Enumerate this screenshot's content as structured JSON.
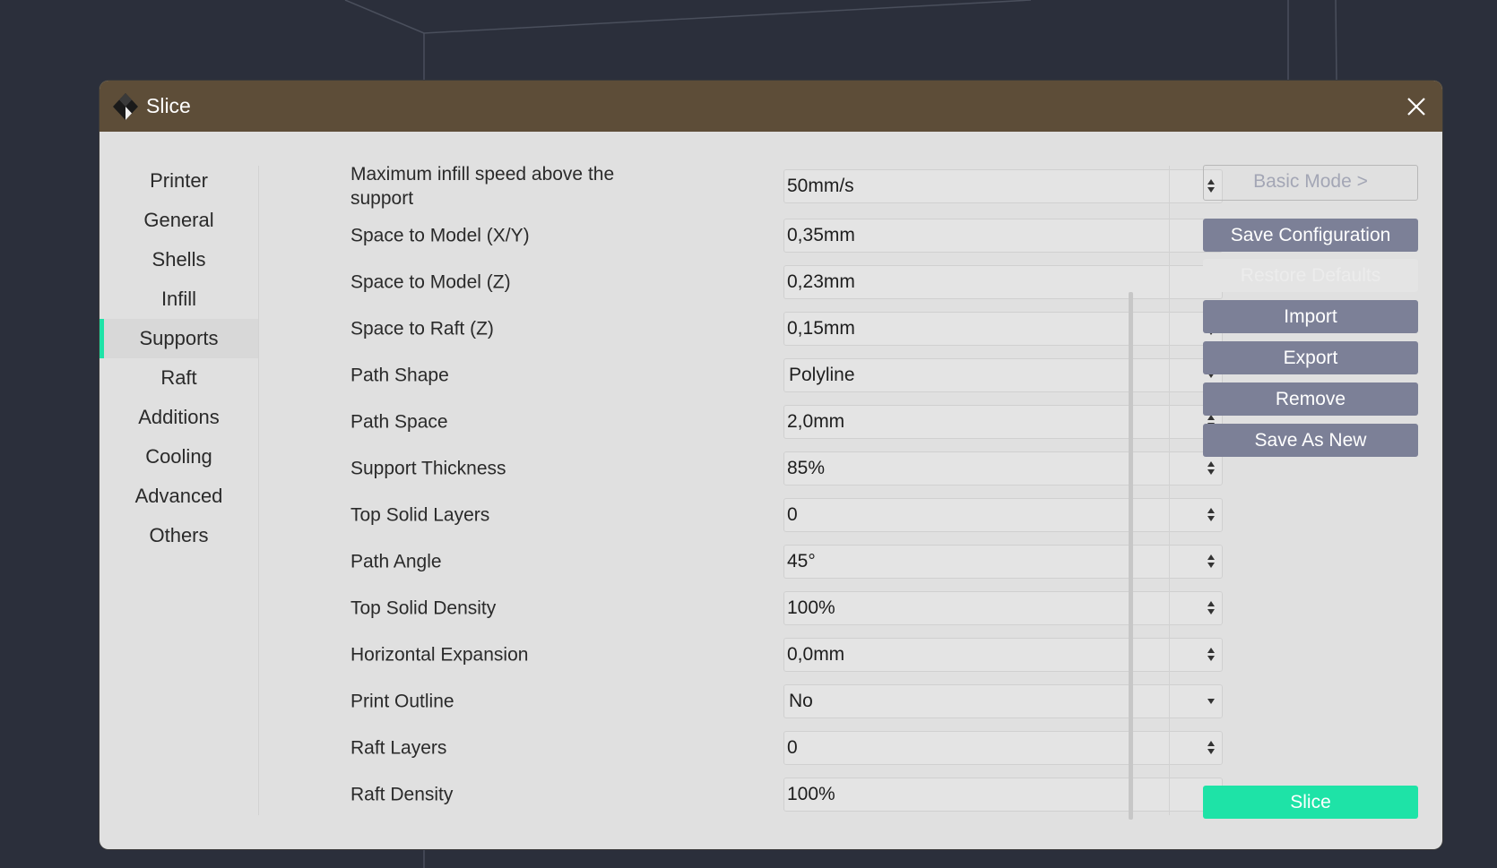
{
  "window": {
    "title": "Slice"
  },
  "sidebar": {
    "items": [
      {
        "label": "Printer"
      },
      {
        "label": "General"
      },
      {
        "label": "Shells"
      },
      {
        "label": "Infill"
      },
      {
        "label": "Supports",
        "active": true
      },
      {
        "label": "Raft"
      },
      {
        "label": "Additions"
      },
      {
        "label": "Cooling"
      },
      {
        "label": "Advanced"
      },
      {
        "label": "Others"
      }
    ]
  },
  "settings": {
    "rows": [
      {
        "label": "Maximum infill speed above the support",
        "value": "50mm/s",
        "control": "spinbox"
      },
      {
        "label": "Space to Model (X/Y)",
        "value": "0,35mm",
        "control": "spinbox"
      },
      {
        "label": "Space to Model (Z)",
        "value": "0,23mm",
        "control": "spinbox"
      },
      {
        "label": "Space to Raft (Z)",
        "value": "0,15mm",
        "control": "spinbox"
      },
      {
        "label": "Path Shape",
        "value": "Polyline",
        "control": "dropdown"
      },
      {
        "label": "Path Space",
        "value": "2,0mm",
        "control": "spinbox"
      },
      {
        "label": "Support Thickness",
        "value": "85%",
        "control": "spinbox"
      },
      {
        "label": "Top Solid Layers",
        "value": "0",
        "control": "spinbox"
      },
      {
        "label": "Path Angle",
        "value": "45°",
        "control": "spinbox"
      },
      {
        "label": "Top Solid Density",
        "value": "100%",
        "control": "spinbox"
      },
      {
        "label": "Horizontal Expansion",
        "value": "0,0mm",
        "control": "spinbox"
      },
      {
        "label": "Print Outline",
        "value": "No",
        "control": "dropdown"
      },
      {
        "label": "Raft Layers",
        "value": "0",
        "control": "spinbox"
      },
      {
        "label": "Raft Density",
        "value": "100%",
        "control": "spinbox"
      }
    ]
  },
  "actions": {
    "basic_mode": "Basic Mode >",
    "save_configuration": "Save Configuration",
    "restore_defaults": "Restore Defaults",
    "import": "Import",
    "export": "Export",
    "remove": "Remove",
    "save_as_new": "Save As New",
    "slice": "Slice"
  },
  "colors": {
    "titlebar": "#5d4d38",
    "accent": "#1ee3a7",
    "button": "#7c8097",
    "panel": "#e0e0e0",
    "background": "#2b2f3b"
  },
  "icons": {
    "app": "app-logo-icon",
    "close": "close-icon",
    "spinbox": "spin-arrows-icon",
    "dropdown": "chevron-down-icon"
  }
}
